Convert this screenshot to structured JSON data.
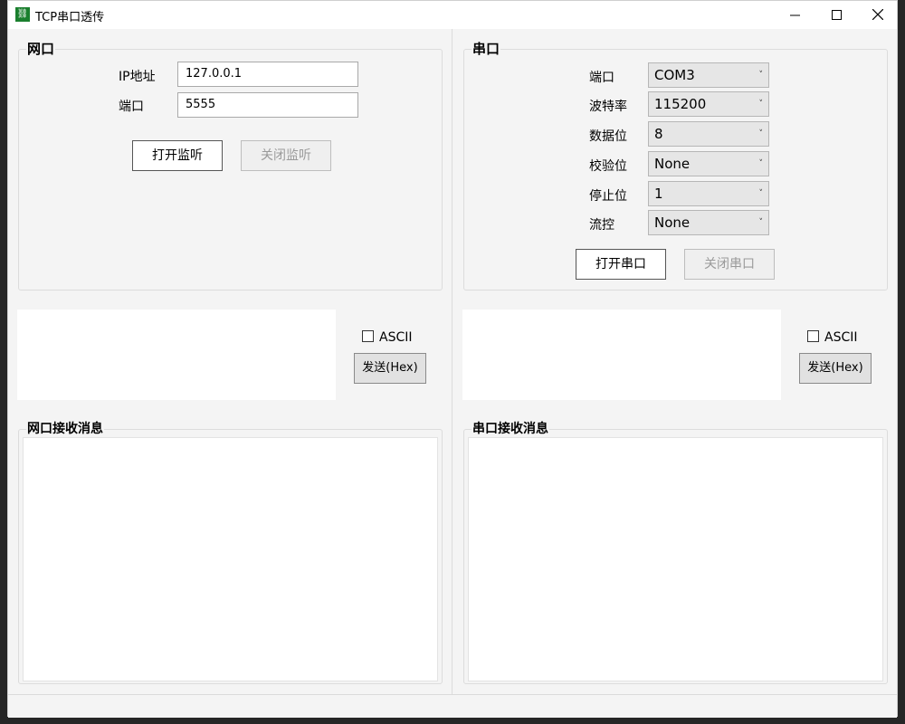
{
  "window": {
    "title": "TCP串口透传",
    "icon": "link-icon"
  },
  "network": {
    "group_title": "网口",
    "ip_label": "IP地址",
    "ip_value": "127.0.0.1",
    "port_label": "端口",
    "port_value": "5555",
    "open_button": "打开监听",
    "close_button": "关闭监听"
  },
  "serial": {
    "group_title": "串口",
    "fields": [
      {
        "label": "端口",
        "value": "COM3"
      },
      {
        "label": "波特率",
        "value": "115200"
      },
      {
        "label": "数据位",
        "value": "8"
      },
      {
        "label": "校验位",
        "value": "None"
      },
      {
        "label": "停止位",
        "value": "1"
      },
      {
        "label": "流控",
        "value": "None"
      }
    ],
    "open_button": "打开串口",
    "close_button": "关闭串口"
  },
  "send_left": {
    "ascii_label": "ASCII",
    "send_button": "发送(Hex)"
  },
  "send_right": {
    "ascii_label": "ASCII",
    "send_button": "发送(Hex)"
  },
  "receive": {
    "network_title": "网口接收消息",
    "serial_title": "串口接收消息"
  }
}
